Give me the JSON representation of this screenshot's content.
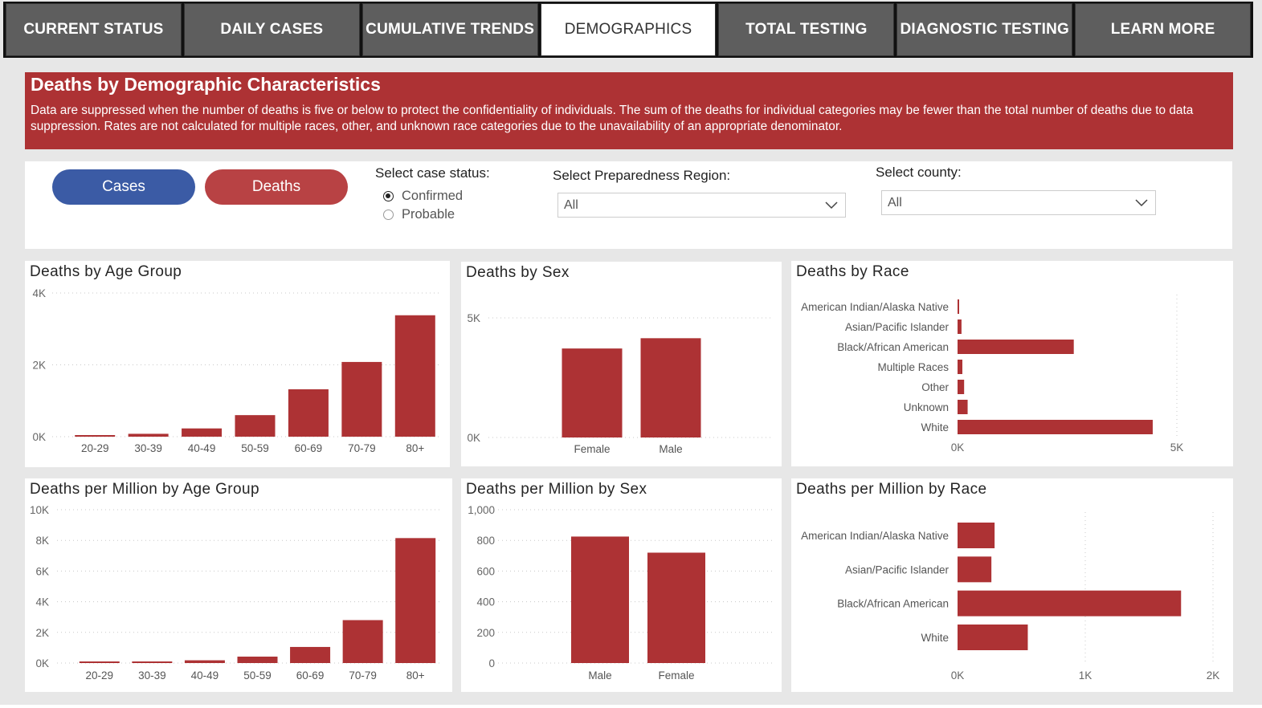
{
  "nav": {
    "tabs": [
      {
        "label": "CURRENT STATUS",
        "active": false
      },
      {
        "label": "DAILY CASES",
        "active": false
      },
      {
        "label": "CUMULATIVE TRENDS",
        "active": false
      },
      {
        "label": "DEMOGRAPHICS",
        "active": true
      },
      {
        "label": "TOTAL TESTING",
        "active": false
      },
      {
        "label": "DIAGNOSTIC TESTING",
        "active": false
      },
      {
        "label": "LEARN MORE",
        "active": false
      }
    ]
  },
  "banner": {
    "title": "Deaths by Demographic Characteristics",
    "text": "Data are suppressed when the number of deaths is five or below to protect the confidentiality of individuals. The sum of the deaths for individual categories may be fewer than the total number of deaths due to data suppression. Rates are not calculated for multiple races, other, and unknown race categories due to the unavailability of an appropriate denominator."
  },
  "filters": {
    "cases_button": "Cases",
    "deaths_button": "Deaths",
    "case_status_label": "Select case status:",
    "case_status_options": [
      "Confirmed",
      "Probable"
    ],
    "case_status_selected": "Confirmed",
    "region_label": "Select Preparedness Region:",
    "region_value": "All",
    "county_label": "Select county:",
    "county_value": "All"
  },
  "colors": {
    "bar": "#ad3234",
    "cases_button": "#3b5ba5",
    "deaths_button": "#b84244",
    "banner": "#ad3234"
  },
  "chart_data": [
    {
      "id": "age",
      "type": "bar",
      "title": "Deaths by Age Group",
      "categories": [
        "20-29",
        "30-39",
        "40-49",
        "50-59",
        "60-69",
        "70-79",
        "80+"
      ],
      "values": [
        30,
        80,
        230,
        600,
        1320,
        2080,
        3380
      ],
      "yticks": [
        {
          "v": 0,
          "label": "0K"
        },
        {
          "v": 2000,
          "label": "2K"
        },
        {
          "v": 4000,
          "label": "4K"
        }
      ],
      "ylim": [
        0,
        4000
      ]
    },
    {
      "id": "sex",
      "type": "bar",
      "title": "Deaths by Sex",
      "categories": [
        "Female",
        "Male"
      ],
      "values": [
        3720,
        4150
      ],
      "yticks": [
        {
          "v": 0,
          "label": "0K"
        },
        {
          "v": 5000,
          "label": "5K"
        }
      ],
      "ylim": [
        0,
        5000
      ]
    },
    {
      "id": "race",
      "type": "bar",
      "orientation": "horizontal",
      "title": "Deaths by Race",
      "categories": [
        "American Indian/Alaska Native",
        "Asian/Pacific Islander",
        "Black/African American",
        "Multiple Races",
        "Other",
        "Unknown",
        "White"
      ],
      "values": [
        30,
        90,
        2650,
        110,
        150,
        230,
        4450
      ],
      "xticks": [
        {
          "v": 0,
          "label": "0K"
        },
        {
          "v": 5000,
          "label": "5K"
        }
      ],
      "xlim": [
        0,
        5000
      ]
    },
    {
      "id": "age_pm",
      "type": "bar",
      "title": "Deaths per Million by Age Group",
      "categories": [
        "20-29",
        "30-39",
        "40-49",
        "50-59",
        "60-69",
        "70-79",
        "80+"
      ],
      "values": [
        50,
        100,
        180,
        420,
        1050,
        2800,
        8150
      ],
      "yticks": [
        {
          "v": 0,
          "label": "0K"
        },
        {
          "v": 2000,
          "label": "2K"
        },
        {
          "v": 4000,
          "label": "4K"
        },
        {
          "v": 6000,
          "label": "6K"
        },
        {
          "v": 8000,
          "label": "8K"
        },
        {
          "v": 10000,
          "label": "10K"
        }
      ],
      "ylim": [
        0,
        10000
      ]
    },
    {
      "id": "sex_pm",
      "type": "bar",
      "title": "Deaths per Million by Sex",
      "categories": [
        "Male",
        "Female"
      ],
      "values": [
        825,
        720
      ],
      "yticks": [
        {
          "v": 0,
          "label": "0"
        },
        {
          "v": 200,
          "label": "200"
        },
        {
          "v": 400,
          "label": "400"
        },
        {
          "v": 600,
          "label": "600"
        },
        {
          "v": 800,
          "label": "800"
        },
        {
          "v": 1000,
          "label": "1,000"
        }
      ],
      "ylim": [
        0,
        1000
      ]
    },
    {
      "id": "race_pm",
      "type": "bar",
      "orientation": "horizontal",
      "title": "Deaths per Million by Race",
      "categories": [
        "American Indian/Alaska Native",
        "Asian/Pacific Islander",
        "Black/African American",
        "White"
      ],
      "values": [
        290,
        265,
        1750,
        550
      ],
      "xticks": [
        {
          "v": 0,
          "label": "0K"
        },
        {
          "v": 1000,
          "label": "1K"
        },
        {
          "v": 2000,
          "label": "2K"
        }
      ],
      "xlim": [
        0,
        2000
      ]
    }
  ]
}
